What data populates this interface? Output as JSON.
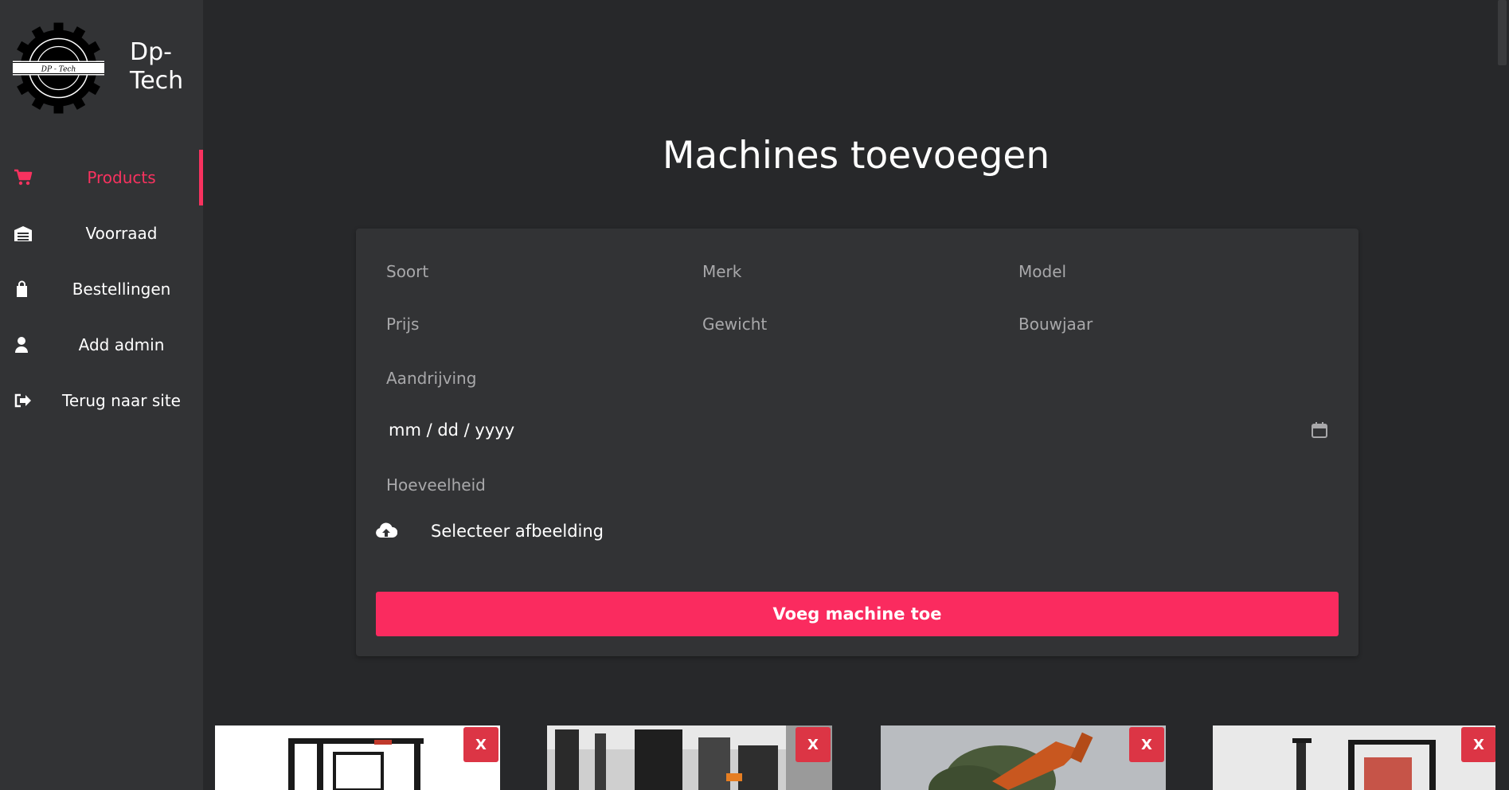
{
  "colors": {
    "accent": "#f8325f",
    "danger": "#dc3545",
    "sidebar_bg": "#323335",
    "page_bg": "#27282a"
  },
  "brand": {
    "name": "Dp-Tech",
    "logo_text": "DP - Tech"
  },
  "sidebar": {
    "items": [
      {
        "label": "Products",
        "icon": "cart-icon",
        "active": true
      },
      {
        "label": "Voorraad",
        "icon": "warehouse-icon",
        "active": false
      },
      {
        "label": "Bestellingen",
        "icon": "bag-icon",
        "active": false
      },
      {
        "label": "Add admin",
        "icon": "user-icon",
        "active": false
      },
      {
        "label": "Terug naar site",
        "icon": "sign-out-icon",
        "active": false
      }
    ]
  },
  "page": {
    "title": "Machines toevoegen"
  },
  "form": {
    "soort": {
      "placeholder": "Soort",
      "value": ""
    },
    "merk": {
      "placeholder": "Merk",
      "value": ""
    },
    "model": {
      "placeholder": "Model",
      "value": ""
    },
    "prijs": {
      "placeholder": "Prijs",
      "value": ""
    },
    "gewicht": {
      "placeholder": "Gewicht",
      "value": ""
    },
    "bouwjaar": {
      "placeholder": "Bouwjaar",
      "value": ""
    },
    "aandrijving": {
      "placeholder": "Aandrijving",
      "value": ""
    },
    "date": {
      "placeholder": "mm / dd / yyyy",
      "icon": "calendar-icon"
    },
    "hoeveelheid": {
      "placeholder": "Hoeveelheid",
      "value": ""
    },
    "upload": {
      "label": "Selecteer afbeelding",
      "icon": "cloud-upload-icon"
    },
    "submit_label": "Voeg machine toe"
  },
  "products": [
    {
      "delete_label": "X"
    },
    {
      "delete_label": "X"
    },
    {
      "delete_label": "X"
    },
    {
      "delete_label": "X"
    }
  ]
}
